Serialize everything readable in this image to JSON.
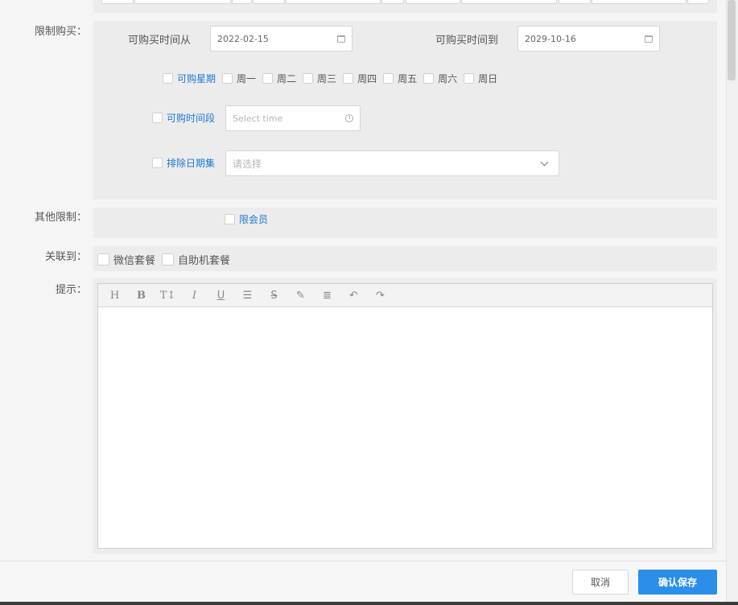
{
  "top_row": {},
  "limit_purchase": {
    "section_label": "限制购买：",
    "time_from_label": "可购买时间从",
    "time_from_value": "2022-02-15",
    "time_to_label": "可购买时间到",
    "time_to_value": "2029-10-16",
    "weekday_label": "可购星期",
    "weekdays": [
      "周一",
      "周二",
      "周三",
      "周四",
      "周五",
      "周六",
      "周日"
    ],
    "time_range_label": "可购时间段",
    "time_range_placeholder": "Select time",
    "exclude_dates_label": "排除日期集",
    "exclude_dates_placeholder": "请选择"
  },
  "other_limit": {
    "section_label": "其他限制：",
    "member_only_label": "限会员"
  },
  "link_to": {
    "section_label": "关联到：",
    "options": [
      "微信套餐",
      "自助机套餐"
    ]
  },
  "hint": {
    "section_label": "提示：",
    "toolbar": [
      "heading-icon",
      "bold-icon",
      "text-size-icon",
      "italic-icon",
      "underline-icon",
      "list-icon",
      "strikethrough-icon",
      "pen-icon",
      "align-icon",
      "undo-icon",
      "redo-icon"
    ],
    "content": ""
  },
  "footer": {
    "cancel_label": "取消",
    "confirm_label": "确认保存"
  },
  "colors": {
    "accent": "#2b8fe9",
    "link": "#1a78d6",
    "panel": "#ececec"
  }
}
